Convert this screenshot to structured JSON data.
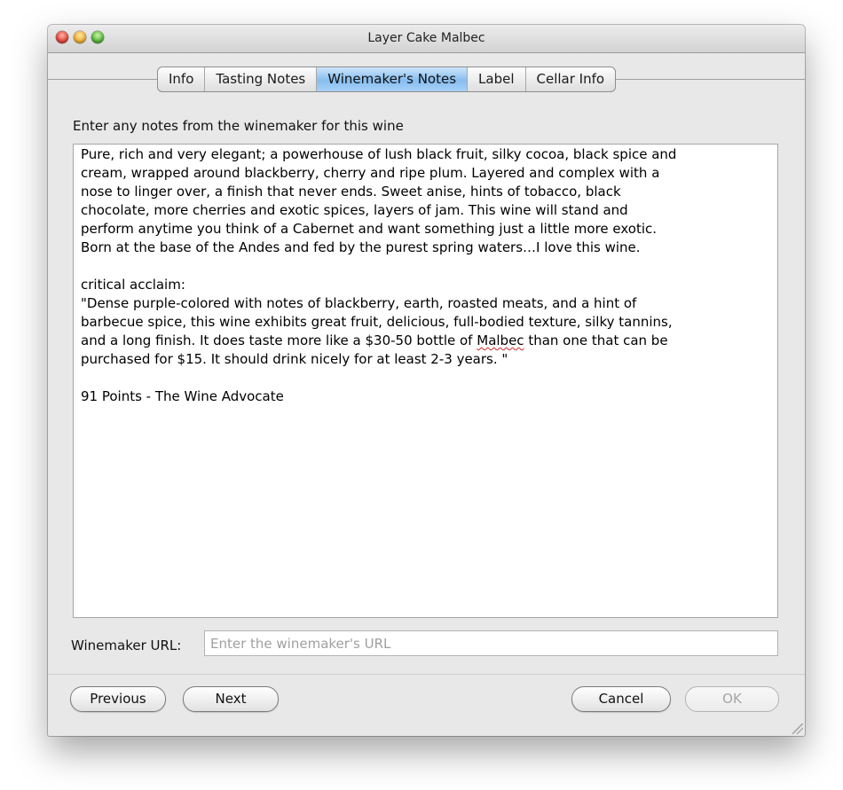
{
  "window": {
    "title": "Layer Cake Malbec"
  },
  "tabs": [
    {
      "label": "Info"
    },
    {
      "label": "Tasting Notes"
    },
    {
      "label": "Winemaker's Notes",
      "selected": true
    },
    {
      "label": "Label"
    },
    {
      "label": "Cellar Info"
    }
  ],
  "main": {
    "prompt": "Enter any notes from the winemaker for this wine",
    "notes": {
      "p1": "Pure, rich and very elegant; a powerhouse of lush black fruit, silky cocoa, black spice and\ncream, wrapped around blackberry, cherry and ripe plum. Layered and complex with a\nnose to linger over, a finish that never ends. Sweet anise, hints of tobacco, black\nchocolate, more cherries and exotic spices, layers of jam. This wine will stand and\nperform anytime you think of a Cabernet and want something just a little more exotic.\nBorn at the base of the Andes and fed by the purest spring waters…I love this wine.",
      "p2_heading": "critical acclaim:",
      "p2_body_before": "\"Dense purple-colored with notes of blackberry, earth, roasted meats, and a hint of\nbarbecue spice, this wine exhibits great fruit, delicious, full-bodied texture, silky tannins,\nand a long finish. It does taste more like a $30-50 bottle of ",
      "p2_spell": "Malbec",
      "p2_body_after": " than one that can be\npurchased for $15. It should drink nicely for at least 2-3 years. \"",
      "p3": "91 Points - The Wine Advocate"
    },
    "url_label": "Winemaker URL:",
    "url_value": "",
    "url_placeholder": "Enter the winemaker's URL"
  },
  "footer": {
    "previous": "Previous",
    "next": "Next",
    "cancel": "Cancel",
    "ok": "OK"
  }
}
